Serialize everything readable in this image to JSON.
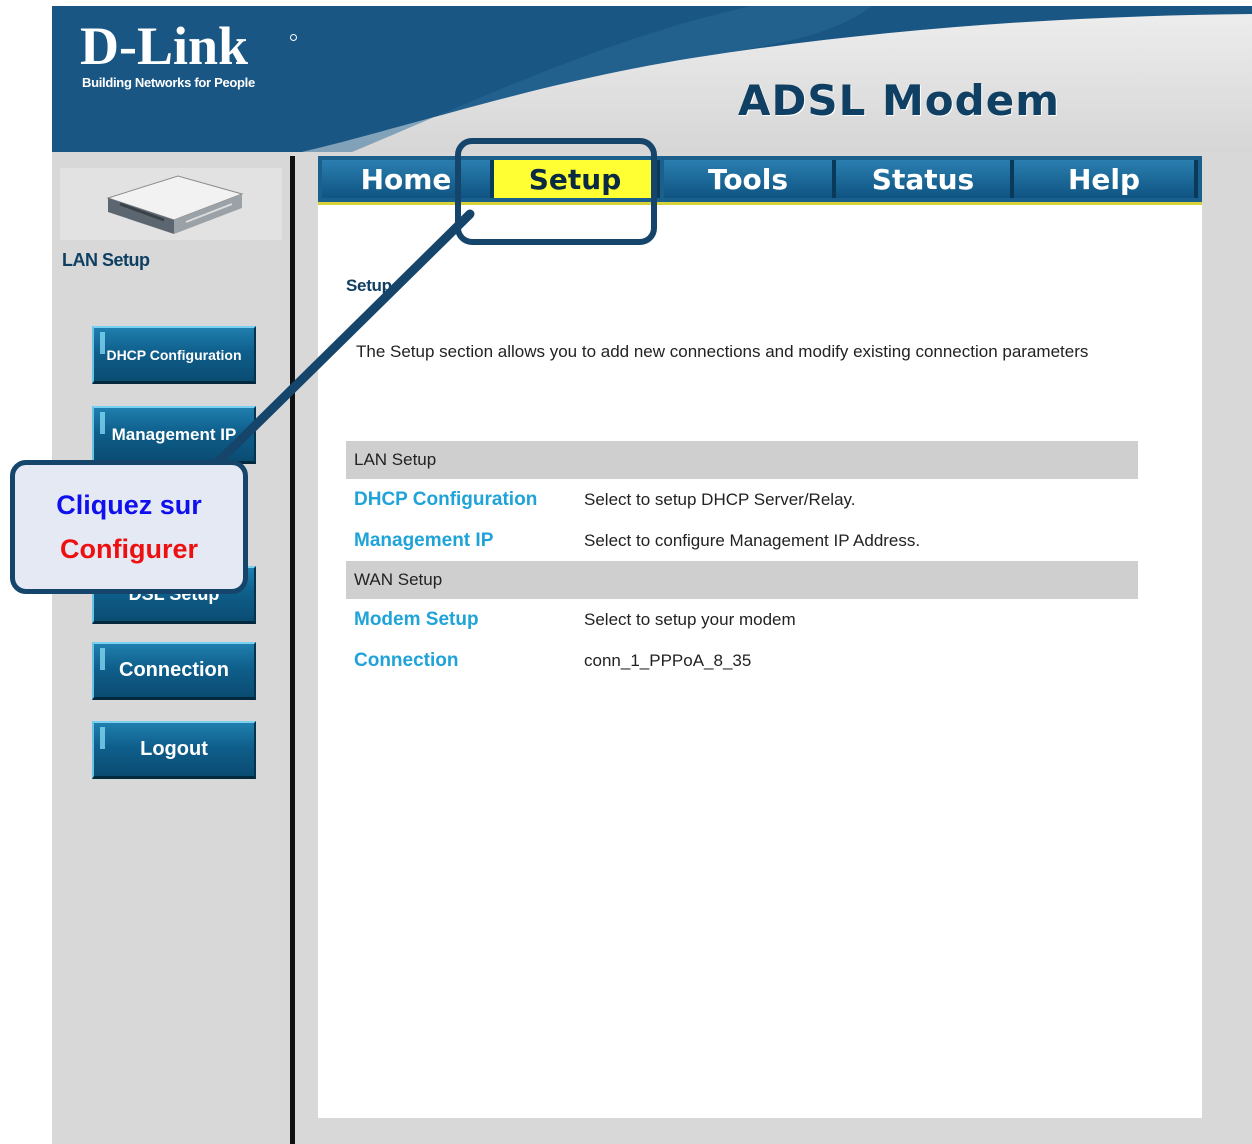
{
  "header": {
    "logo": "D-Link",
    "tagline": "Building Networks for People",
    "product_title": "ADSL Modem"
  },
  "nav_tabs": [
    {
      "label": "Home",
      "active": false
    },
    {
      "label": "Setup",
      "active": true
    },
    {
      "label": "Tools",
      "active": false
    },
    {
      "label": "Status",
      "active": false
    },
    {
      "label": "Help",
      "active": false
    }
  ],
  "sidebar": {
    "section_title": "LAN Setup",
    "buttons": [
      {
        "label": "DHCP Configuration"
      },
      {
        "label": "Management IP"
      },
      {
        "label": "DSL Setup"
      },
      {
        "label": "Connection"
      },
      {
        "label": "Logout"
      }
    ]
  },
  "main": {
    "heading": "Setup",
    "description": "The Setup section allows you to add new connections and modify existing connection parameters",
    "sections": [
      {
        "title": "LAN Setup",
        "rows": [
          {
            "link": "DHCP Configuration",
            "desc": "Select to setup DHCP Server/Relay."
          },
          {
            "link": "Management IP",
            "desc": "Select to configure Management IP Address."
          }
        ]
      },
      {
        "title": "WAN Setup",
        "rows": [
          {
            "link": "Modem Setup",
            "desc": "Select to setup your modem"
          },
          {
            "link": "Connection",
            "desc": "conn_1_PPPoA_8_35"
          }
        ]
      }
    ]
  },
  "callout": {
    "line1": "Cliquez sur",
    "line2": "Configurer"
  },
  "colors": {
    "brand_blue": "#0f5482",
    "active_tab": "#ffff33",
    "link": "#1fa3d8",
    "callout_line1": "#1010ee",
    "callout_line2": "#ee1010"
  }
}
